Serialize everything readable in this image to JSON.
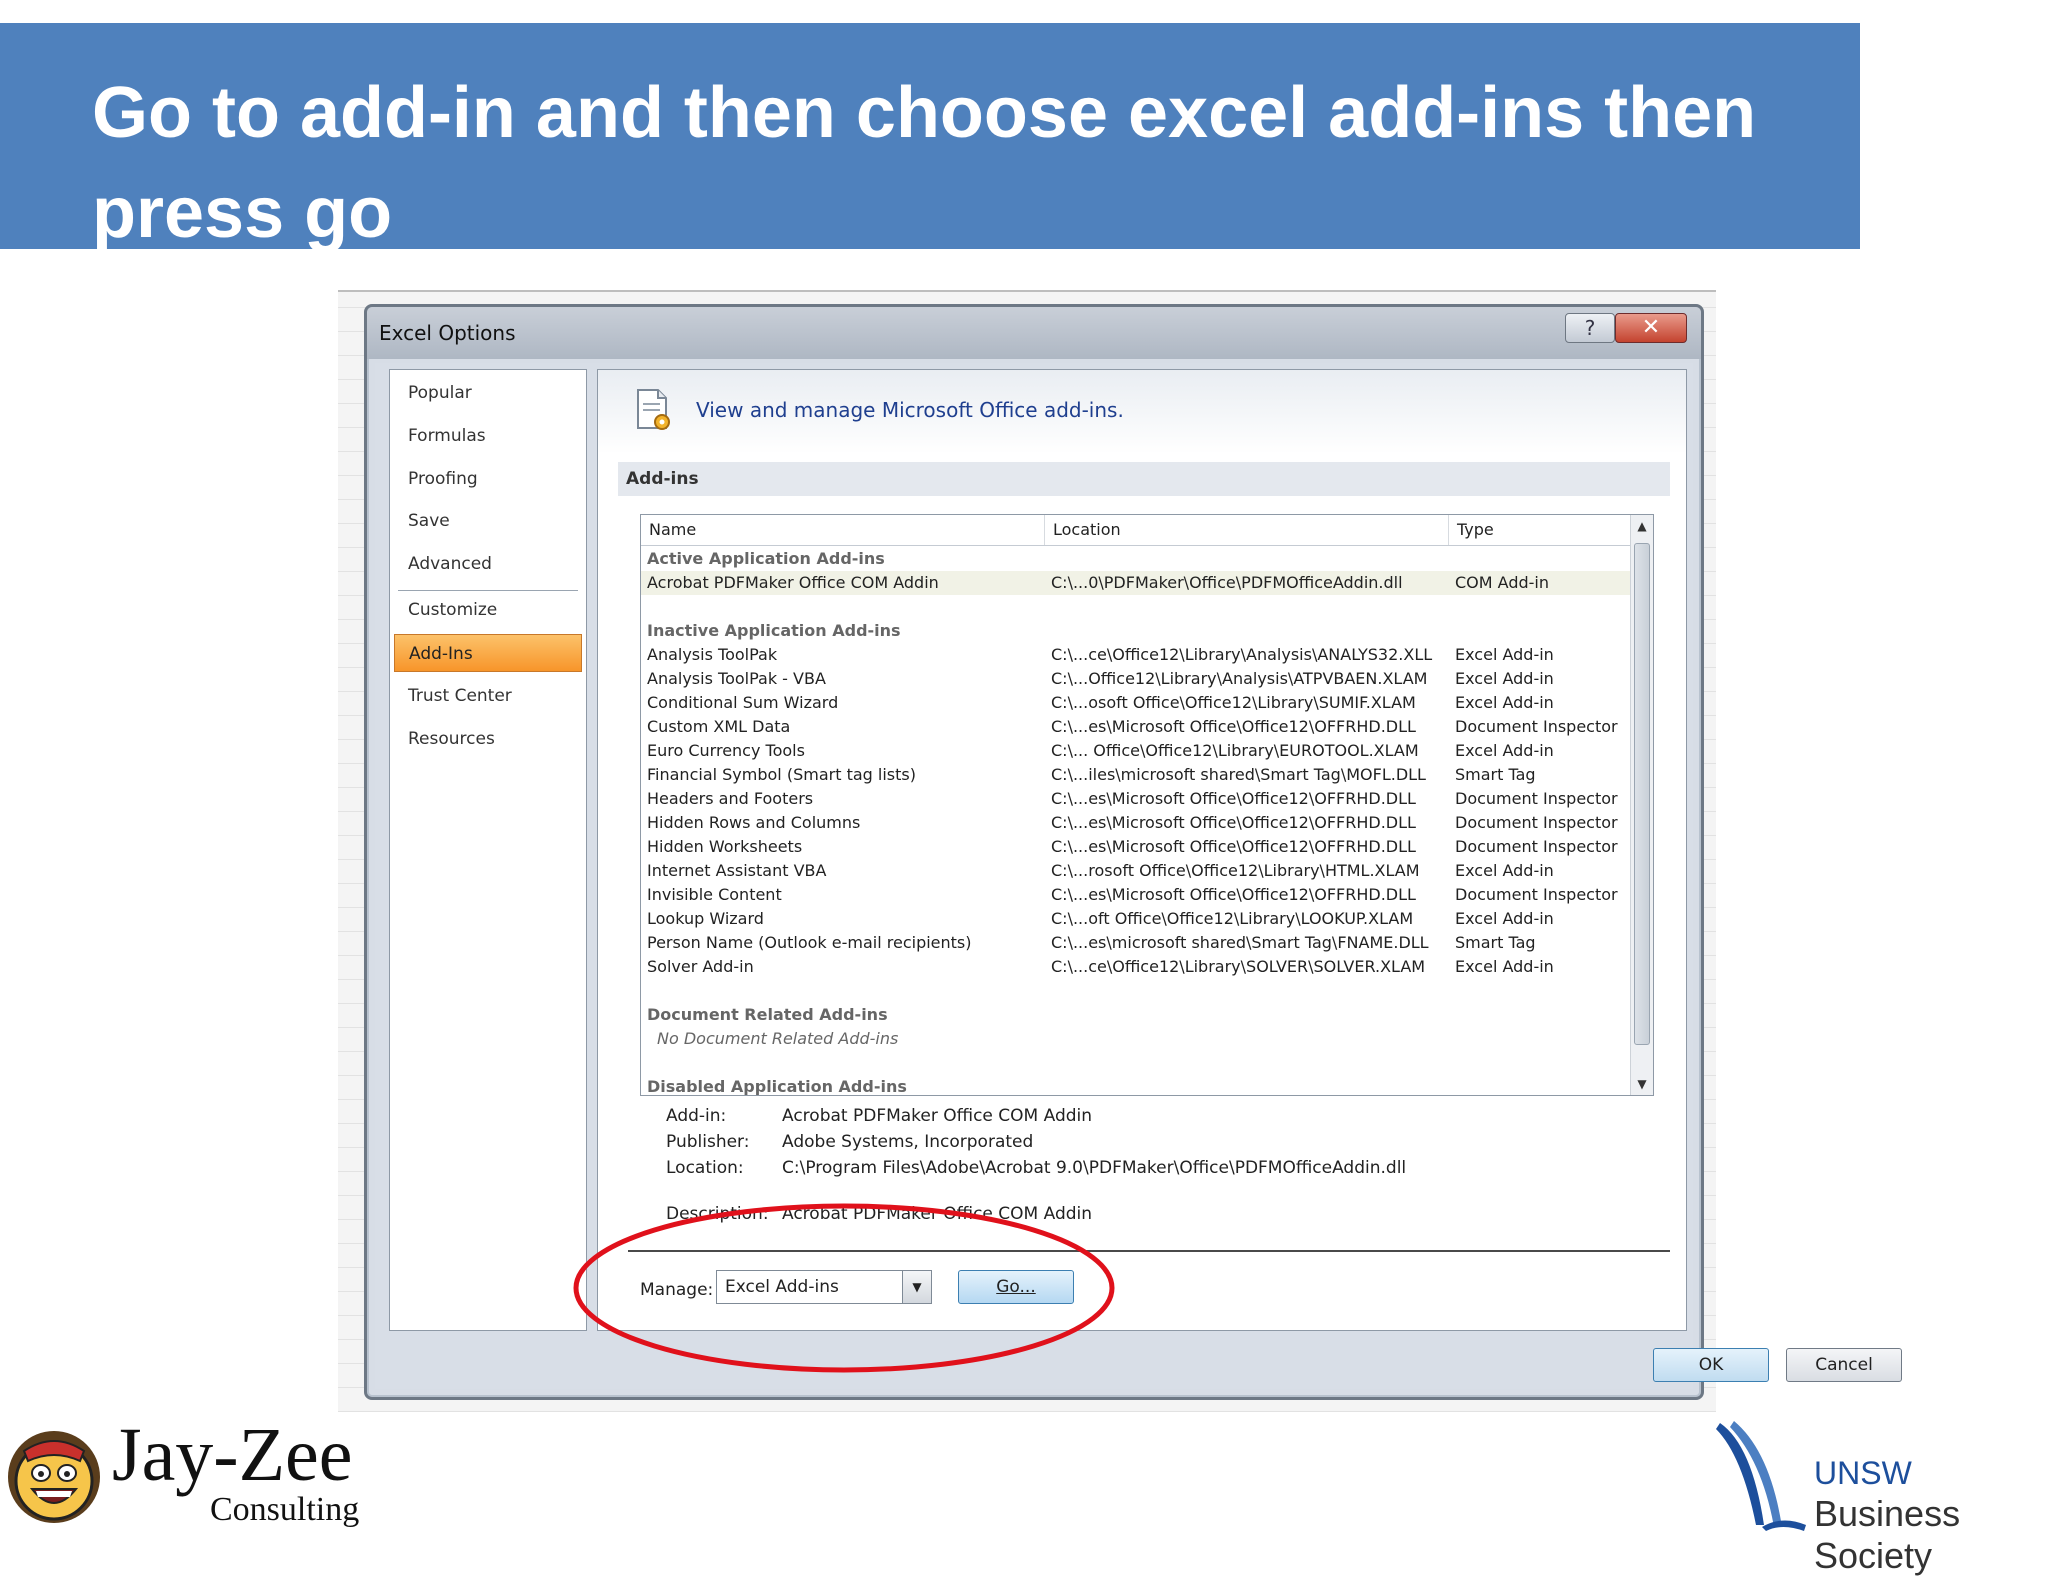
{
  "slide": {
    "title": "Go to add-in and then choose excel add-ins then press go"
  },
  "dialog": {
    "title": "Excel Options",
    "help_label": "?",
    "close_label": "✕"
  },
  "nav": {
    "items": [
      {
        "label": "Popular"
      },
      {
        "label": "Formulas"
      },
      {
        "label": "Proofing"
      },
      {
        "label": "Save"
      },
      {
        "label": "Advanced"
      },
      {
        "label": "Customize"
      },
      {
        "label": "Add-Ins"
      },
      {
        "label": "Trust Center"
      },
      {
        "label": "Resources"
      }
    ],
    "active_index": 6
  },
  "panel": {
    "header_text": "View and manage Microsoft Office add-ins.",
    "section_title": "Add-ins",
    "columns": [
      "Name",
      "Location",
      "Type"
    ],
    "groups": {
      "active": "Active Application Add-ins",
      "inactive": "Inactive Application Add-ins",
      "document": "Document Related Add-ins",
      "document_note": "No Document Related Add-ins",
      "disabled": "Disabled Application Add-ins"
    },
    "active_rows": [
      {
        "name": "Acrobat PDFMaker Office COM Addin",
        "location": "C:\\...0\\PDFMaker\\Office\\PDFMOfficeAddin.dll",
        "type": "COM Add-in"
      }
    ],
    "inactive_rows": [
      {
        "name": "Analysis ToolPak",
        "location": "C:\\...ce\\Office12\\Library\\Analysis\\ANALYS32.XLL",
        "type": "Excel Add-in"
      },
      {
        "name": "Analysis ToolPak - VBA",
        "location": "C:\\...Office12\\Library\\Analysis\\ATPVBAEN.XLAM",
        "type": "Excel Add-in"
      },
      {
        "name": "Conditional Sum Wizard",
        "location": "C:\\...osoft Office\\Office12\\Library\\SUMIF.XLAM",
        "type": "Excel Add-in"
      },
      {
        "name": "Custom XML Data",
        "location": "C:\\...es\\Microsoft Office\\Office12\\OFFRHD.DLL",
        "type": "Document Inspector"
      },
      {
        "name": "Euro Currency Tools",
        "location": "C:\\... Office\\Office12\\Library\\EUROTOOL.XLAM",
        "type": "Excel Add-in"
      },
      {
        "name": "Financial Symbol (Smart tag lists)",
        "location": "C:\\...iles\\microsoft shared\\Smart Tag\\MOFL.DLL",
        "type": "Smart Tag"
      },
      {
        "name": "Headers and Footers",
        "location": "C:\\...es\\Microsoft Office\\Office12\\OFFRHD.DLL",
        "type": "Document Inspector"
      },
      {
        "name": "Hidden Rows and Columns",
        "location": "C:\\...es\\Microsoft Office\\Office12\\OFFRHD.DLL",
        "type": "Document Inspector"
      },
      {
        "name": "Hidden Worksheets",
        "location": "C:\\...es\\Microsoft Office\\Office12\\OFFRHD.DLL",
        "type": "Document Inspector"
      },
      {
        "name": "Internet Assistant VBA",
        "location": "C:\\...rosoft Office\\Office12\\Library\\HTML.XLAM",
        "type": "Excel Add-in"
      },
      {
        "name": "Invisible Content",
        "location": "C:\\...es\\Microsoft Office\\Office12\\OFFRHD.DLL",
        "type": "Document Inspector"
      },
      {
        "name": "Lookup Wizard",
        "location": "C:\\...oft Office\\Office12\\Library\\LOOKUP.XLAM",
        "type": "Excel Add-in"
      },
      {
        "name": "Person Name (Outlook e-mail recipients)",
        "location": "C:\\...es\\microsoft shared\\Smart Tag\\FNAME.DLL",
        "type": "Smart Tag"
      },
      {
        "name": "Solver Add-in",
        "location": "C:\\...ce\\Office12\\Library\\SOLVER\\SOLVER.XLAM",
        "type": "Excel Add-in"
      }
    ],
    "scroll_up": "▲",
    "scroll_down": "▼",
    "details": {
      "addin_label": "Add-in:",
      "addin_value": "Acrobat PDFMaker Office COM Addin",
      "publisher_label": "Publisher:",
      "publisher_value": "Adobe Systems, Incorporated",
      "location_label": "Location:",
      "location_value": "C:\\Program Files\\Adobe\\Acrobat 9.0\\PDFMaker\\Office\\PDFMOfficeAddin.dll",
      "description_label": "Description:",
      "description_value": "Acrobat PDFMaker Office COM Addin"
    },
    "manage_label": "Manage:",
    "manage_value": "Excel Add-ins",
    "manage_arrow": "▼",
    "go_label": "Go...",
    "ok_label": "OK",
    "cancel_label": "Cancel"
  },
  "colors": {
    "banner": "#4f81bd",
    "active_nav": "#f7952a",
    "annotation": "#e0111b"
  },
  "logos": {
    "left_main": "Jay-Zee",
    "left_sub": "Consulting",
    "right_line1": "UNSW",
    "right_line2": "Business Society"
  }
}
